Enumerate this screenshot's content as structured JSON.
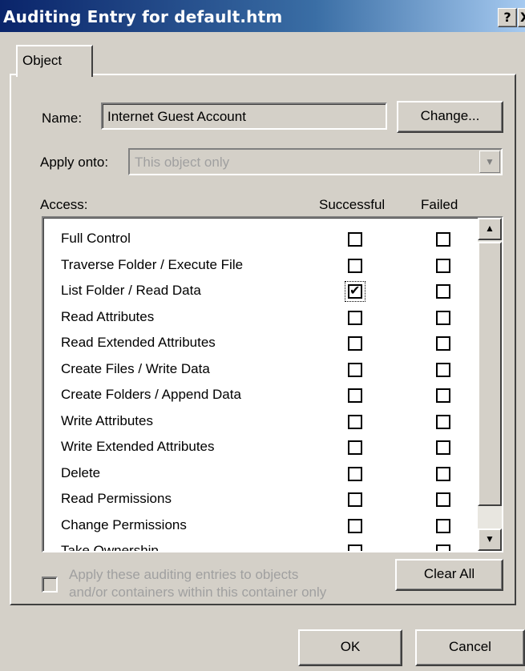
{
  "window": {
    "title": "Auditing Entry for default.htm",
    "help_label": "?",
    "close_label": "X"
  },
  "tabs": [
    {
      "label": "Object"
    }
  ],
  "name_field": {
    "label": "Name:",
    "value": "Internet Guest Account",
    "change_button": "Change..."
  },
  "apply_onto": {
    "label": "Apply onto:",
    "value": "This object only"
  },
  "access": {
    "label": "Access:",
    "col_successful": "Successful",
    "col_failed": "Failed",
    "rows": [
      {
        "name": "Full Control",
        "successful": false,
        "failed": false
      },
      {
        "name": "Traverse Folder / Execute File",
        "successful": false,
        "failed": false
      },
      {
        "name": "List Folder / Read Data",
        "successful": true,
        "failed": false
      },
      {
        "name": "Read Attributes",
        "successful": false,
        "failed": false
      },
      {
        "name": "Read Extended Attributes",
        "successful": false,
        "failed": false
      },
      {
        "name": "Create Files / Write Data",
        "successful": false,
        "failed": false
      },
      {
        "name": "Create Folders / Append Data",
        "successful": false,
        "failed": false
      },
      {
        "name": "Write Attributes",
        "successful": false,
        "failed": false
      },
      {
        "name": "Write Extended Attributes",
        "successful": false,
        "failed": false
      },
      {
        "name": "Delete",
        "successful": false,
        "failed": false
      },
      {
        "name": "Read Permissions",
        "successful": false,
        "failed": false
      },
      {
        "name": "Change Permissions",
        "successful": false,
        "failed": false
      },
      {
        "name": "Take Ownership",
        "successful": false,
        "failed": false
      }
    ]
  },
  "apply_checkbox": {
    "line1": "Apply these auditing entries to objects",
    "line2": "and/or containers within this container only",
    "checked": false
  },
  "buttons": {
    "clear_all": "Clear All",
    "ok": "OK",
    "cancel": "Cancel"
  },
  "icons": {
    "scroll_up": "scroll-up-arrow-icon",
    "scroll_down": "scroll-down-arrow-icon",
    "combo": "dropdown-arrow-icon"
  }
}
